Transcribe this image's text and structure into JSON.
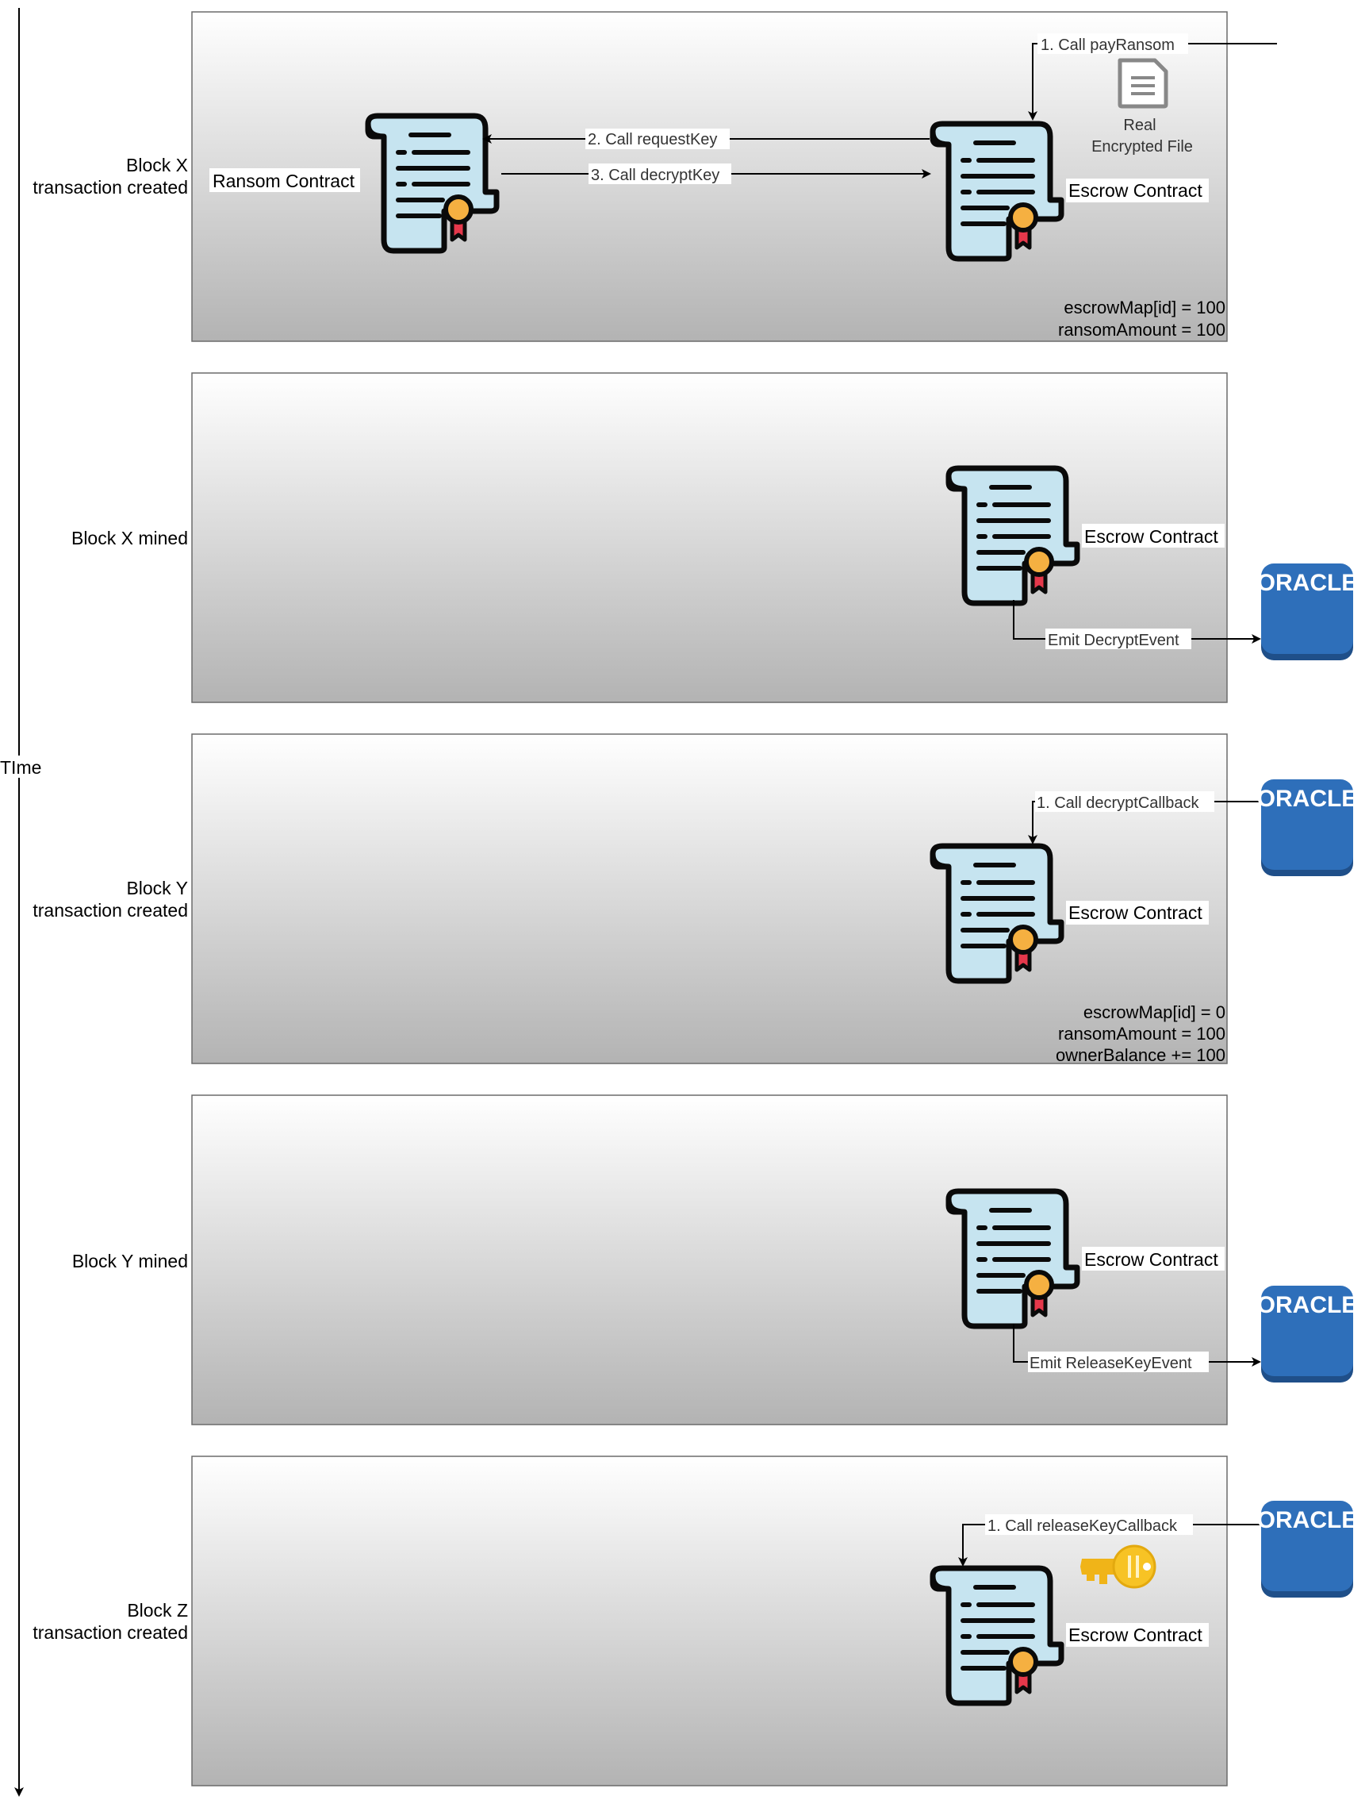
{
  "time_axis": {
    "label": "TIme"
  },
  "panels": [
    {
      "label_lines": [
        "Block X",
        "transaction created"
      ],
      "contract_labels": [
        "Ransom Contract",
        "Escrow Contract"
      ],
      "arrows": [
        "1. Call payRansom",
        "2. Call requestKey",
        "3. Call decryptKey"
      ],
      "file_label_lines": [
        "Real",
        "Encrypted File"
      ],
      "state": [
        "escrowMap[id] = 100",
        "ransomAmount = 100"
      ]
    },
    {
      "label_lines": [
        "Block X mined"
      ],
      "contract_labels": [
        "Escrow Contract"
      ],
      "arrows": [
        "Emit DecryptEvent"
      ],
      "oracle_label": "ORACLE"
    },
    {
      "label_lines": [
        "Block Y",
        "transaction created"
      ],
      "contract_labels": [
        "Escrow Contract"
      ],
      "arrows": [
        "1. Call decryptCallback"
      ],
      "oracle_label": "ORACLE",
      "state": [
        "escrowMap[id] = 0",
        "ransomAmount = 100",
        "ownerBalance += 100"
      ]
    },
    {
      "label_lines": [
        "Block Y mined"
      ],
      "contract_labels": [
        "Escrow Contract"
      ],
      "arrows": [
        "Emit ReleaseKeyEvent"
      ],
      "oracle_label": "ORACLE"
    },
    {
      "label_lines": [
        "Block Z",
        "transaction created"
      ],
      "contract_labels": [
        "Escrow Contract"
      ],
      "arrows": [
        "1. Call releaseKeyCallback"
      ],
      "oracle_label": "ORACLE"
    }
  ],
  "colors": {
    "panel_top": "#ffffff",
    "panel_bottom": "#b3b3b3",
    "scroll_fill": "#c6e4f0",
    "medal": "#f5b041",
    "ribbon": "#e5384b",
    "oracle": "#2e6fba",
    "oracle_dark": "#1f4f89",
    "key": "#f7c325",
    "file_icon": "#888888"
  },
  "icons": [
    "contract-scroll-icon",
    "oracle-icon",
    "encrypted-file-icon",
    "key-icon"
  ]
}
